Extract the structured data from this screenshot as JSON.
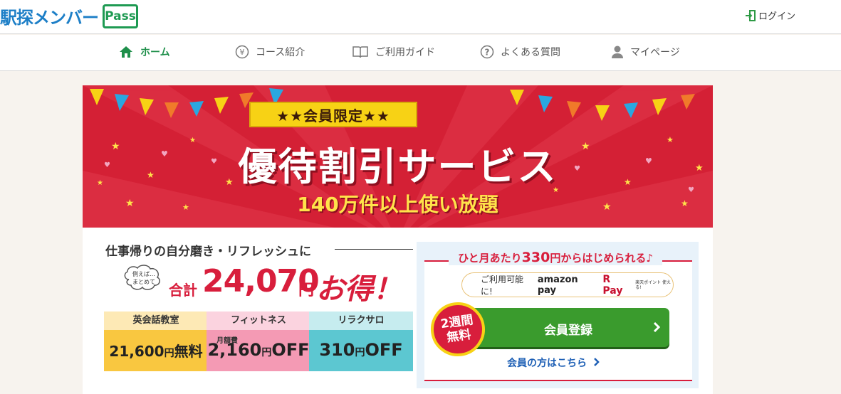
{
  "header": {
    "logo_text": "駅探メンバー",
    "logo_badge": "Pass",
    "login_label": "ログイン",
    "login_icon": "login-icon"
  },
  "nav": {
    "items": [
      {
        "label": "ホーム",
        "icon": "home-icon",
        "active": true
      },
      {
        "label": "コース紹介",
        "icon": "yen-icon",
        "active": false
      },
      {
        "label": "ご利用ガイド",
        "icon": "book-icon",
        "active": false
      },
      {
        "label": "よくある質問",
        "icon": "question-icon",
        "active": false
      },
      {
        "label": "マイページ",
        "icon": "user-icon",
        "active": false
      }
    ]
  },
  "banner": {
    "ribbon": "★★会員限定★★",
    "title": "優待割引サービス",
    "subtitle": "140万件以上使い放題",
    "colors": {
      "background": "#d42035",
      "title": "#ffffff",
      "subtitle": "#ffe34a",
      "ribbon": "#f7d215"
    }
  },
  "savings": {
    "lead": "仕事帰りの自分磨き・リフレッシュに",
    "cloud_note_1": "例えば…",
    "cloud_note_2": "まとめて",
    "total_label": "合計",
    "total_amount": "24,070",
    "total_unit": "円",
    "total_suffix": "お得！",
    "categories": [
      {
        "name": "英会話教室",
        "note": "",
        "amount": "21,600",
        "unit": "円",
        "suffix": "無料",
        "head_color": "#fde9b5",
        "body_color": "#f9c740"
      },
      {
        "name": "フィットネス",
        "note": "月額費",
        "amount": "2,160",
        "unit": "円",
        "suffix": "OFF",
        "head_color": "#fbd3df",
        "body_color": "#f49ab4"
      },
      {
        "name": "リラクサロ",
        "note": "",
        "amount": "310",
        "unit": "円",
        "suffix": "OFF",
        "head_color": "#c6ecef",
        "body_color": "#5cc7d1"
      }
    ]
  },
  "signup": {
    "headline_pre": "ひと月あたり",
    "headline_price": "330",
    "headline_post": "円からはじめられる♪",
    "pay_label": "ご利用可能に!",
    "amazon_pay": "amazon pay",
    "r_pay": "R Pay",
    "r_pay_note": "楽天ポイント 使える!",
    "badge_line1": "2週間",
    "badge_line2": "無料",
    "register_button": "会員登録",
    "member_link": "会員の方はこちら"
  }
}
